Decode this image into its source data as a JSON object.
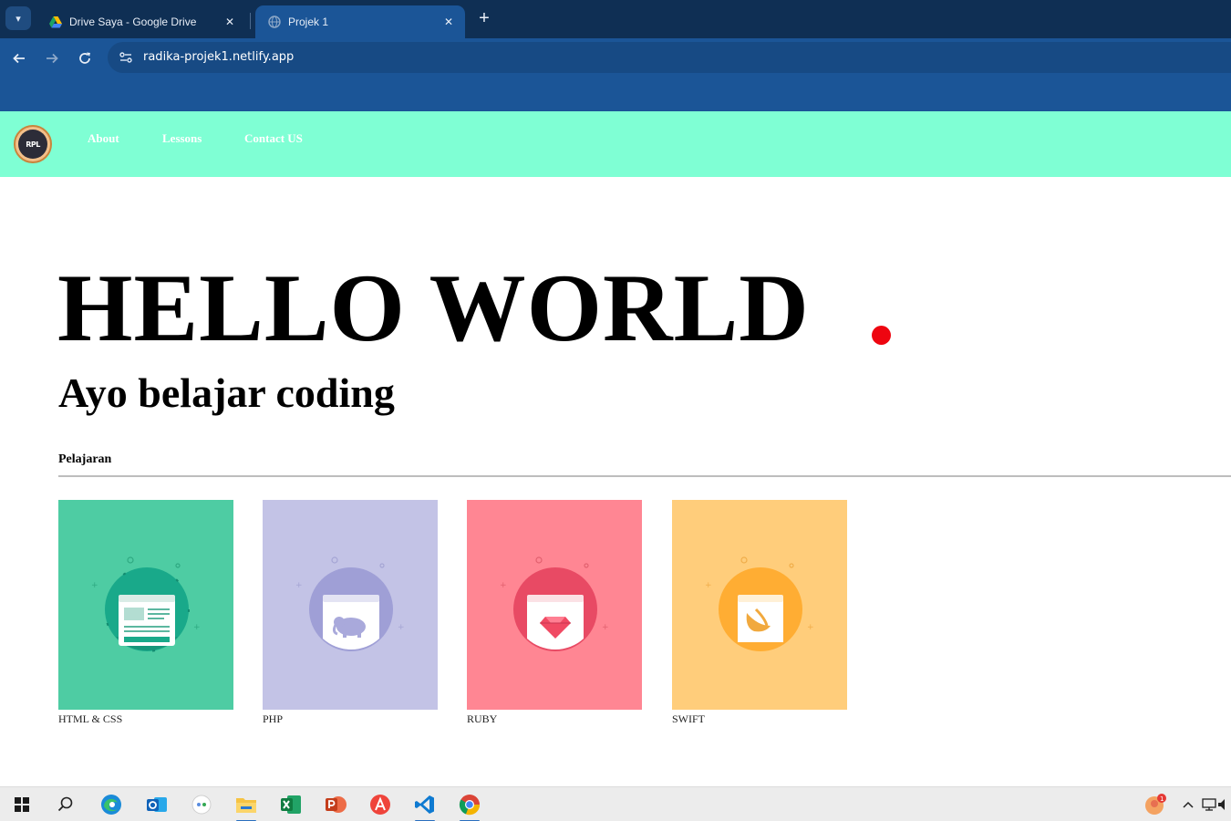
{
  "browser": {
    "tabs": [
      {
        "title": "Drive Saya - Google Drive",
        "close": "✕",
        "active": false
      },
      {
        "title": "Projek 1",
        "close": "✕",
        "active": true
      }
    ],
    "new_tab": "+",
    "url": "radika-projek1.netlify.app",
    "menu_icon": "chevron-down-icon"
  },
  "site": {
    "logo_text": "RPL",
    "nav": [
      "About",
      "Lessons",
      "Contact US"
    ],
    "header_color": "#7fffd4"
  },
  "hero": {
    "title": "HELLO WORLD",
    "subtitle": "Ayo belajar coding",
    "dot_color": "#ee0510"
  },
  "lessons": {
    "heading": "Pelajaran",
    "items": [
      {
        "label": "HTML & CSS",
        "color": "#4ecca3",
        "icon": "webpage-icon"
      },
      {
        "label": "PHP",
        "color": "#c3c3e6",
        "icon": "elephant-icon"
      },
      {
        "label": "RUBY",
        "color": "#ff8693",
        "icon": "gem-icon"
      },
      {
        "label": "SWIFT",
        "color": "#ffcd7b",
        "icon": "swift-bird-icon"
      }
    ]
  },
  "taskbar": {
    "icons": [
      "windows-start-icon",
      "search-icon",
      "edge-icon",
      "outlook-icon",
      "meet-icon",
      "file-explorer-icon",
      "excel-icon",
      "powerpoint-icon",
      "anydesk-icon",
      "vscode-icon",
      "chrome-icon"
    ],
    "tray": [
      "notification-avatar-icon",
      "chevron-up-icon",
      "network-icon",
      "volume-icon"
    ]
  }
}
